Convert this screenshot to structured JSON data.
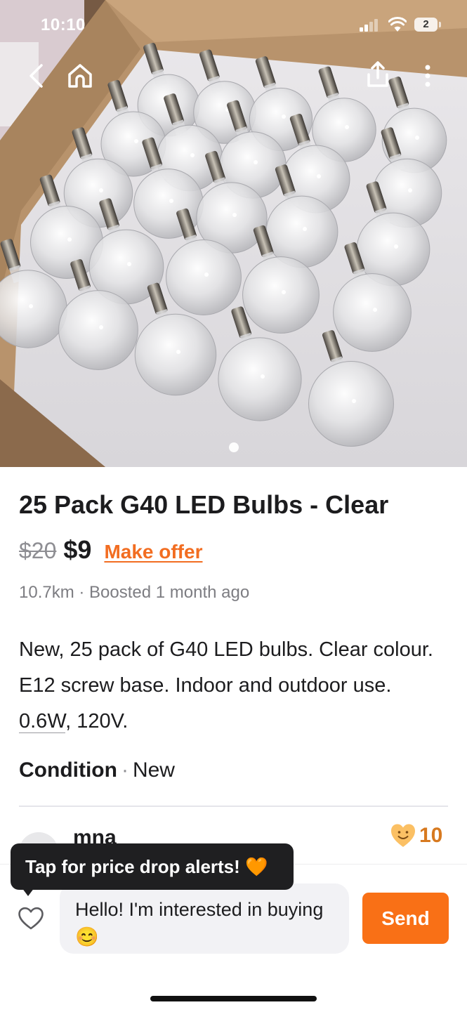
{
  "status_bar": {
    "time": "10:10",
    "battery": "2"
  },
  "photo": {
    "alt": "Box of clear round light bulbs in foam packaging",
    "carousel_pages": 1,
    "carousel_active": 1
  },
  "toolbar": {
    "back_icon": "chevron-left-icon",
    "home_icon": "home-icon",
    "share_icon": "share-icon",
    "more_icon": "more-vertical-icon"
  },
  "listing": {
    "title": "25 Pack G40 LED Bulbs - Clear",
    "original_price": "$20",
    "price": "$9",
    "make_offer_label": "Make offer",
    "meta": "10.7km · Boosted 1 month ago",
    "description_part1": "New, 25 pack of G40 LED bulbs.  Clear colour.  E12 screw base. Indoor and outdoor use. ",
    "description_underlined": "0.6W",
    "description_part2": ", 120V.",
    "condition_label": "Condition",
    "condition_sep": "·",
    "condition_value": "New"
  },
  "seller": {
    "name": "mna",
    "rating_icon": "smiling-heart-icon",
    "rating_count": "10"
  },
  "tooltip": {
    "text": "Tap for price drop alerts! 🧡"
  },
  "message": {
    "value": "Hello! I'm interested in buying 😊",
    "send_label": "Send",
    "favorite_icon": "heart-outline-icon"
  },
  "colors": {
    "accent": "#f97016",
    "offer_link": "#f26d21",
    "tooltip_bg": "#1f1f21",
    "rating": "#d7791f"
  }
}
